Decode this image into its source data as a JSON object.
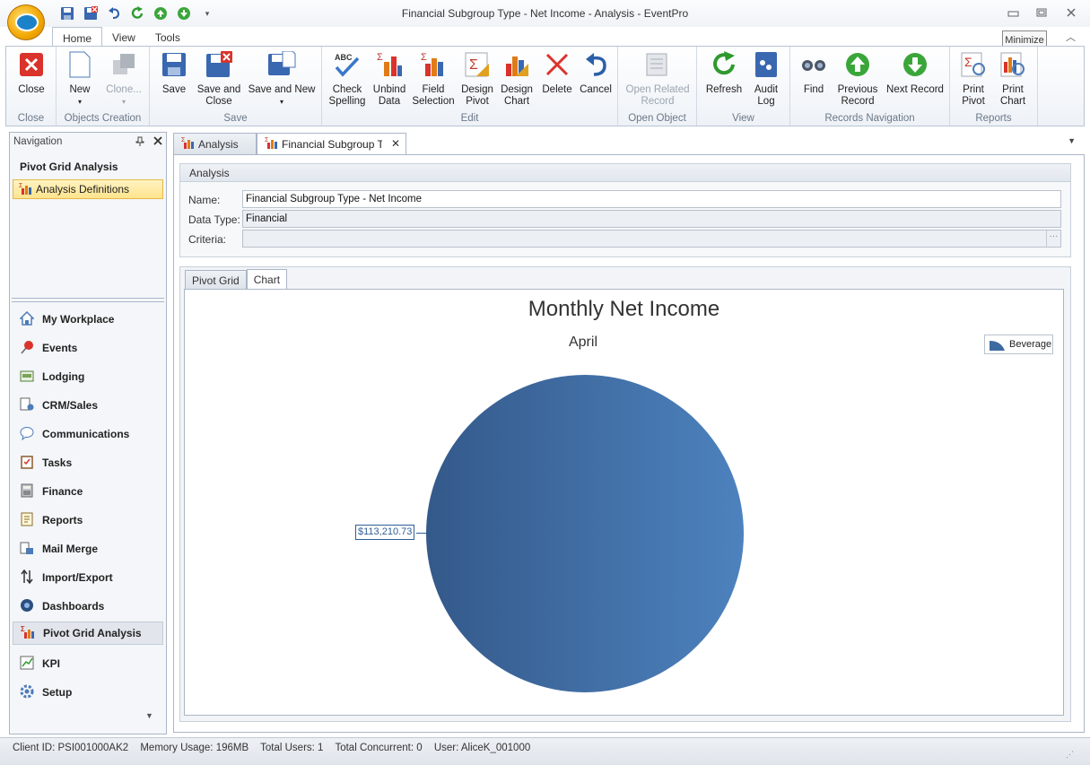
{
  "window": {
    "title": "Financial Subgroup Type - Net Income - Analysis - EventPro",
    "tooltip": "Minimize"
  },
  "ribbon_tabs": [
    "Home",
    "View",
    "Tools"
  ],
  "ribbon": {
    "groups": {
      "close": "Close",
      "objects_creation": "Objects Creation",
      "save": "Save",
      "edit": "Edit",
      "open_object": "Open Object",
      "view": "View",
      "records_navigation": "Records Navigation",
      "reports": "Reports"
    },
    "buttons": {
      "close": "Close",
      "new": "New",
      "clone": "Clone...",
      "save": "Save",
      "save_close_1": "Save and",
      "save_close_2": "Close",
      "save_new": "Save and New",
      "check_1": "Check",
      "check_2": "Spelling",
      "unbind_1": "Unbind",
      "unbind_2": "Data",
      "field_1": "Field",
      "field_2": "Selection",
      "dpivot_1": "Design",
      "dpivot_2": "Pivot",
      "dchart_1": "Design",
      "dchart_2": "Chart",
      "delete": "Delete",
      "cancel": "Cancel",
      "open_related_1": "Open Related",
      "open_related_2": "Record",
      "refresh": "Refresh",
      "audit_1": "Audit",
      "audit_2": "Log",
      "find": "Find",
      "prev_1": "Previous",
      "prev_2": "Record",
      "next": "Next Record",
      "print_pivot_1": "Print",
      "print_pivot_2": "Pivot",
      "print_chart_1": "Print",
      "print_chart_2": "Chart"
    }
  },
  "navigation": {
    "header": "Navigation",
    "section_title": "Pivot Grid Analysis",
    "selected_item": "Analysis Definitions",
    "items": [
      {
        "label": "My Workplace",
        "icon": "house-icon"
      },
      {
        "label": "Events",
        "icon": "pushpin-icon"
      },
      {
        "label": "Lodging",
        "icon": "lodging-icon"
      },
      {
        "label": "CRM/Sales",
        "icon": "crm-icon"
      },
      {
        "label": "Communications",
        "icon": "speech-bubble-icon"
      },
      {
        "label": "Tasks",
        "icon": "clipboard-icon"
      },
      {
        "label": "Finance",
        "icon": "calculator-icon"
      },
      {
        "label": "Reports",
        "icon": "report-icon"
      },
      {
        "label": "Mail Merge",
        "icon": "mail-merge-icon"
      },
      {
        "label": "Import/Export",
        "icon": "import-export-icon"
      },
      {
        "label": "Dashboards",
        "icon": "dashboard-icon"
      },
      {
        "label": "Pivot Grid Analysis",
        "icon": "pivot-icon"
      },
      {
        "label": "KPI",
        "icon": "kpi-icon"
      },
      {
        "label": "Setup",
        "icon": "gear-icon"
      }
    ]
  },
  "doc_tabs": {
    "tab1": "Analysis",
    "tab2": "Financial Subgroup Type"
  },
  "analysis": {
    "header": "Analysis",
    "name_label": "Name:",
    "name_value": "Financial Subgroup Type - Net Income",
    "datatype_label": "Data Type:",
    "datatype_value": "Financial",
    "criteria_label": "Criteria:",
    "criteria_value": "",
    "criteria_button": "···"
  },
  "inner_tabs": {
    "pivot": "Pivot Grid",
    "chart": "Chart"
  },
  "chart_data": {
    "type": "pie",
    "title": "Monthly Net Income",
    "subtitle": "April",
    "series": [
      {
        "name": "Beverage",
        "values": [
          113210.73
        ],
        "color": "#3d6aa0"
      }
    ],
    "data_labels": [
      "$113,210.73"
    ],
    "legend_position": "top-right"
  },
  "status": {
    "client": "Client ID: PSI001000AK2",
    "memory": "Memory Usage: 196MB",
    "users": "Total Users: 1",
    "concurrent": "Total Concurrent: 0",
    "user": "User: AliceK_001000"
  }
}
